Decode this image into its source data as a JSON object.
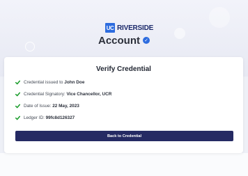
{
  "brand": {
    "logo_mark": "UC",
    "logo_text": "RIVERSIDE",
    "brand_color": "#2d6cdf",
    "text_color": "#1c2a6b"
  },
  "header": {
    "title": "Account",
    "verified_icon": "verified-check-icon"
  },
  "card": {
    "title": "Verify Credential",
    "rows": [
      {
        "label": "Credential issued to ",
        "value": "John Doe",
        "icon": "check-icon"
      },
      {
        "label": "Credential Signatory: ",
        "value": "Vice Chancellor, UCR",
        "icon": "check-icon"
      },
      {
        "label": "Date of Issue: ",
        "value": "22 May, 2023",
        "icon": "check-icon"
      },
      {
        "label": "Ledger ID: ",
        "value": "99fc8d126327",
        "icon": "check-icon"
      }
    ],
    "check_color": "#1a9c2b",
    "button_label": "Back to Credential",
    "button_color": "#252a63"
  }
}
